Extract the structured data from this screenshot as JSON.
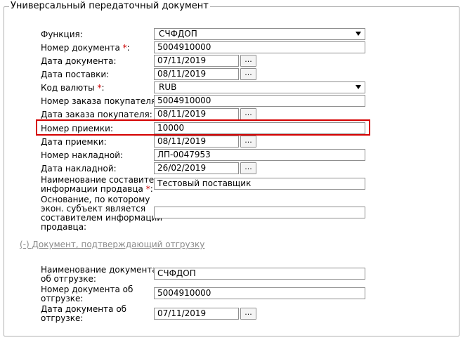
{
  "form_title": "Универсальный передаточный документ",
  "picker_button_label": "...",
  "required_marker": "*",
  "fields": {
    "function": {
      "label": "Функция:",
      "value": "СЧФДОП"
    },
    "doc_number": {
      "label": "Номер документа ",
      "value": "5004910000"
    },
    "doc_date": {
      "label": "Дата документа:",
      "value": "07/11/2019"
    },
    "delivery_date": {
      "label": "Дата поставки:",
      "value": "08/11/2019"
    },
    "currency_code": {
      "label": "Код валюты ",
      "value": "RUB"
    },
    "buyer_order_number": {
      "label": "Номер заказа покупателя:",
      "value": "5004910000"
    },
    "buyer_order_date": {
      "label": "Дата заказа покупателя:",
      "value": "08/11/2019"
    },
    "acceptance_number": {
      "label": "Номер приемки:",
      "value": "10000"
    },
    "acceptance_date": {
      "label": "Дата приемки:",
      "value": "08/11/2019"
    },
    "waybill_number": {
      "label": "Номер накладной:",
      "value": "ЛП-0047953"
    },
    "waybill_date": {
      "label": "Дата накладной:",
      "value": "26/02/2019"
    },
    "seller_info_name": {
      "label_line1": "Наименование составителя",
      "label_line2": "информации продавца ",
      "value": "Тестовый поставщик"
    },
    "basis": {
      "label_line1": "Основание, по которому",
      "label_line2": "экон. субъект является",
      "label_line3": "составителем информации",
      "label_line4": "продавца:",
      "value": ""
    }
  },
  "shipment_section": {
    "link_label": "(-) Документ, подтверждающий отгрузку",
    "doc_name": {
      "label_line1": "Наименование документа",
      "label_line2": "об отгрузке:",
      "value": "СЧФДОП"
    },
    "doc_number": {
      "label_line1": "Номер документа об",
      "label_line2": "отгрузке:",
      "value": "5004910000"
    },
    "doc_date": {
      "label_line1": "Дата документа об",
      "label_line2": "отгрузке:",
      "value": "07/11/2019"
    }
  }
}
